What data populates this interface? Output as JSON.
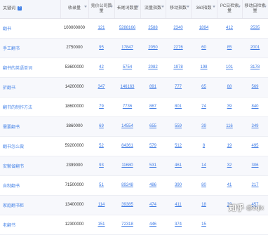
{
  "headers": [
    {
      "label": "关键词"
    },
    {
      "label": "收录量"
    },
    {
      "label": "竞价公司数量"
    },
    {
      "label": "长尾词数量"
    },
    {
      "label": "流量指数"
    },
    {
      "label": "移动指数"
    },
    {
      "label": "360指数"
    },
    {
      "label": "PC日检索量"
    },
    {
      "label": "移动日检索量"
    }
  ],
  "info_icon_label": "?",
  "rows": [
    {
      "keyword": "翻书",
      "shoulu": "100000000",
      "jingjia": "121",
      "changwei": "5288166",
      "liuliang": "2588",
      "yidong": "2340",
      "s360": "1894",
      "pc": "412",
      "mobile": "2535"
    },
    {
      "keyword": "手工翻书",
      "shoulu": "2750000",
      "jingjia": "95",
      "changwei": "17847",
      "liuliang": "2050",
      "yidong": "2276",
      "s360": "60",
      "pc": "85",
      "mobile": "2001"
    },
    {
      "keyword": "翻书的英语单词",
      "shoulu": "53600000",
      "jingjia": "42",
      "changwei": "5754",
      "liuliang": "2082",
      "yidong": "1978",
      "s360": "198",
      "pc": "101",
      "mobile": "3178"
    },
    {
      "keyword": "折翻书",
      "shoulu": "14200000",
      "jingjia": "347",
      "changwei": "146163",
      "liuliang": "891",
      "yidong": "777",
      "s360": "65",
      "pc": "88",
      "mobile": "569"
    },
    {
      "keyword": "翻书的制作方法",
      "shoulu": "18600000",
      "jingjia": "79",
      "changwei": "7736",
      "liuliang": "867",
      "yidong": "801",
      "s360": "74",
      "pc": "39",
      "mobile": "840"
    },
    {
      "keyword": "需要翻书",
      "shoulu": "3860000",
      "jingjia": "69",
      "changwei": "14554",
      "liuliang": "655",
      "yidong": "559",
      "s360": "39",
      "pc": "116",
      "mobile": "349"
    },
    {
      "keyword": "翻书怎么做",
      "shoulu": "59200000",
      "jingjia": "52",
      "changwei": "84361",
      "liuliang": "579",
      "yidong": "512",
      "s360": "8",
      "pc": "19",
      "mobile": "495"
    },
    {
      "keyword": "安徽省翻书",
      "shoulu": "2399000",
      "jingjia": "93",
      "changwei": "11680",
      "liuliang": "531",
      "yidong": "461",
      "s360": "14",
      "pc": "32",
      "mobile": "306"
    },
    {
      "keyword": "自制翻书",
      "shoulu": "71500000",
      "jingjia": "51",
      "changwei": "89248",
      "liuliang": "486",
      "yidong": "390",
      "s360": "80",
      "pc": "41",
      "mobile": "217"
    },
    {
      "keyword": "家庭翻书柜",
      "shoulu": "13400000",
      "jingjia": "114",
      "changwei": "39385",
      "liuliang": "474",
      "yidong": "411",
      "s360": "18",
      "pc": "32",
      "mobile": "457"
    },
    {
      "keyword": "老翻书",
      "shoulu": "12300000",
      "jingjia": "151",
      "changwei": "72318",
      "liuliang": "446",
      "yidong": "374",
      "s360": "15",
      "pc": "",
      "mobile": ""
    }
  ],
  "watermark": {
    "site": "知乎",
    "handle": "@zqlx"
  }
}
